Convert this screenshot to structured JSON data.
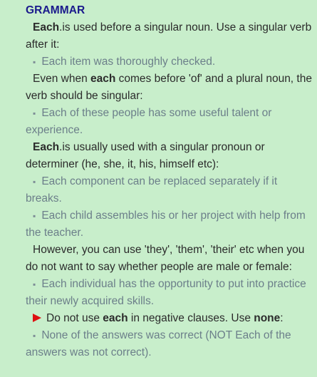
{
  "section": {
    "heading": "GRAMMAR"
  },
  "blocks": [
    {
      "kind": "rule",
      "bold_lead": "Each",
      "text": ".is used before a singular noun. Use a singular verb after it:"
    },
    {
      "kind": "example",
      "text": "Each item was thoroughly checked."
    },
    {
      "kind": "rule",
      "before": "Even when ",
      "bold": "each",
      "after": " comes before 'of' and a plural noun, the verb should be singular:"
    },
    {
      "kind": "example",
      "text": "Each of these people has some useful talent or experience."
    },
    {
      "kind": "rule",
      "bold_lead": "Each",
      "text": ".is usually used with a singular pronoun or determiner (he, she, it, his, himself etc):"
    },
    {
      "kind": "example",
      "text": "Each component can be replaced separately if it breaks."
    },
    {
      "kind": "example",
      "text": "Each child assembles his or her project with help from the teacher."
    },
    {
      "kind": "rule",
      "text": "However, you can use 'they', 'them', 'their' etc when you do not want to say whether people are male or female:"
    },
    {
      "kind": "example",
      "text": "Each individual has the opportunity to put into practice their newly acquired skills."
    },
    {
      "kind": "warning",
      "before": "Do not use ",
      "bold1": "each",
      "middle": " in negative clauses. Use ",
      "bold2": "none",
      "after": ":"
    },
    {
      "kind": "example",
      "text": "None of the answers was correct (NOT Each of the answers was not correct)."
    }
  ],
  "icons": {
    "bullet": "square-bullet-icon",
    "warning": "red-triangle-arrow-icon"
  },
  "colors": {
    "background": "#c8eecb",
    "heading": "#1a1a8c",
    "rule_text": "#2b2b2b",
    "example_text": "#6c7f8a",
    "arrow": "#dd1111"
  }
}
